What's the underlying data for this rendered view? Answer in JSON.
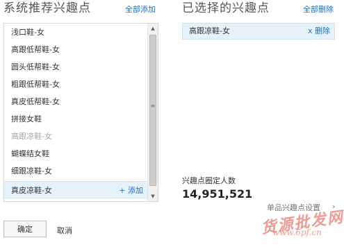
{
  "left_panel": {
    "title": "系统推荐兴趣点",
    "add_all": "全部添加",
    "items": [
      {
        "label": "浅口鞋-女",
        "state": "normal"
      },
      {
        "label": "高跟低帮鞋-女",
        "state": "normal"
      },
      {
        "label": "圆头低帮鞋-女",
        "state": "normal"
      },
      {
        "label": "粗跟低帮鞋-女",
        "state": "normal"
      },
      {
        "label": "真皮低帮鞋-女",
        "state": "normal"
      },
      {
        "label": "拼接女鞋",
        "state": "normal"
      },
      {
        "label": "高跟凉鞋-女",
        "state": "disabled"
      },
      {
        "label": "蝴蝶结女鞋",
        "state": "normal"
      },
      {
        "label": "细跟凉鞋-女",
        "state": "normal"
      },
      {
        "label": "真皮凉鞋-女",
        "state": "selected",
        "action": "+ 添加"
      }
    ]
  },
  "right_panel": {
    "title": "已选择的兴趣点",
    "remove_all": "全部删除",
    "selected": [
      {
        "label": "高跟凉鞋-女",
        "remove": "x 删除"
      }
    ],
    "audience_label": "兴趣点圈定人数",
    "audience_value": "14,951,521",
    "settings_link": "单品兴趣点设置"
  },
  "buttons": {
    "ok": "确定",
    "cancel": "取消"
  },
  "watermark": {
    "logo": "货源批发网",
    "url": "www.6pf.cn"
  },
  "colors": {
    "link": "#1b6fc4",
    "selected_bg": "#e5f1fb",
    "watermark": "#e04a3c"
  }
}
